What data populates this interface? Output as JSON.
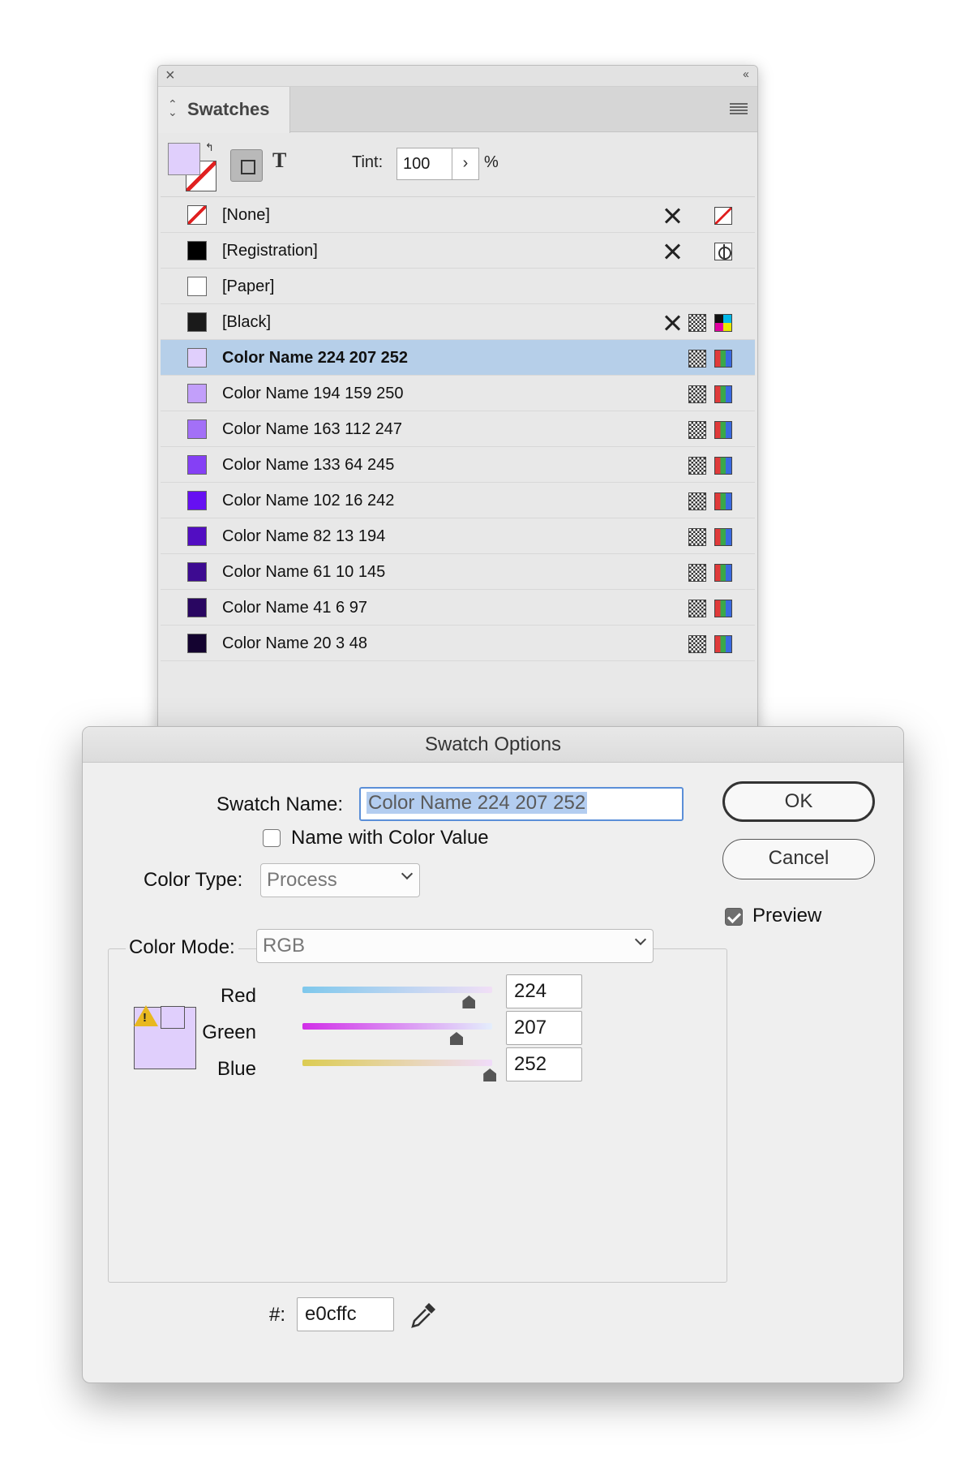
{
  "swatches_panel": {
    "tab_label": "Swatches",
    "tint_label": "Tint:",
    "tint_value": "100",
    "tint_unit": "%",
    "fill_color": "#e0cffc",
    "items": [
      {
        "label": "[None]",
        "color": "none",
        "icons": [
          "pencil-slash-icon",
          "none-icon"
        ]
      },
      {
        "label": "[Registration]",
        "color": "#000000",
        "icons": [
          "pencil-slash-icon",
          "registration-icon"
        ]
      },
      {
        "label": "[Paper]",
        "color": "#ffffff",
        "icons": []
      },
      {
        "label": "[Black]",
        "color": "#1a1a1a",
        "icons": [
          "pencil-slash-icon",
          "process-color-icon",
          "cmyk-icon"
        ]
      },
      {
        "label": "Color Name 224 207 252",
        "color": "#e0cffc",
        "icons": [
          "process-color-icon",
          "rgb-icon"
        ],
        "selected": true
      },
      {
        "label": "Color Name 194 159 250",
        "color": "#c29ffa",
        "icons": [
          "process-color-icon",
          "rgb-icon"
        ]
      },
      {
        "label": "Color Name 163 112 247",
        "color": "#a370f7",
        "icons": [
          "process-color-icon",
          "rgb-icon"
        ]
      },
      {
        "label": "Color Name 133 64 245",
        "color": "#8540f5",
        "icons": [
          "process-color-icon",
          "rgb-icon"
        ]
      },
      {
        "label": "Color Name 102 16 242",
        "color": "#6610f2",
        "icons": [
          "process-color-icon",
          "rgb-icon"
        ]
      },
      {
        "label": "Color Name 82 13 194",
        "color": "#520dc2",
        "icons": [
          "process-color-icon",
          "rgb-icon"
        ]
      },
      {
        "label": "Color Name 61 10 145",
        "color": "#3d0a91",
        "icons": [
          "process-color-icon",
          "rgb-icon"
        ]
      },
      {
        "label": "Color Name 41 6 97",
        "color": "#290661",
        "icons": [
          "process-color-icon",
          "rgb-icon"
        ]
      },
      {
        "label": "Color Name 20 3 48",
        "color": "#140330",
        "icons": [
          "process-color-icon",
          "rgb-icon"
        ]
      }
    ]
  },
  "dialog": {
    "title": "Swatch Options",
    "swatch_name_label": "Swatch Name:",
    "swatch_name_value": "Color Name 224 207 252",
    "name_with_value_label": "Name with Color Value",
    "name_with_value_checked": false,
    "color_type_label": "Color Type:",
    "color_type_value": "Process",
    "color_mode_label": "Color Mode:",
    "color_mode_value": "RGB",
    "ok_label": "OK",
    "cancel_label": "Cancel",
    "preview_label": "Preview",
    "preview_checked": true,
    "sliders": [
      {
        "label": "Red",
        "value": "224",
        "fraction": 0.878
      },
      {
        "label": "Green",
        "value": "207",
        "fraction": 0.812
      },
      {
        "label": "Blue",
        "value": "252",
        "fraction": 0.988
      }
    ],
    "hex_label": "#:",
    "hex_value": "e0cffc",
    "preview_color": "#e0cffc"
  }
}
